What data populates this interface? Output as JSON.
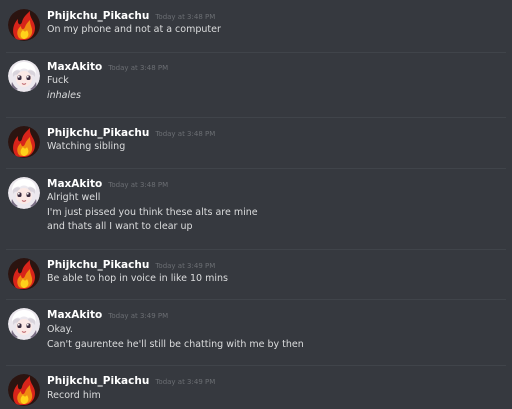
{
  "messages": [
    {
      "author": "Phijkchu_Pikachu",
      "timestamp": "Today at 3:48 PM",
      "lines": [
        "On my phone and not at a computer"
      ]
    },
    {
      "author": "MaxAkito",
      "timestamp": "Today at 3:48 PM",
      "lines": [
        "Fuck",
        "inhales"
      ]
    },
    {
      "author": "Phijkchu_Pikachu",
      "timestamp": "Today at 3:48 PM",
      "lines": [
        "Watching sibling"
      ]
    },
    {
      "author": "MaxAkito",
      "timestamp": "Today at 3:48 PM",
      "lines": [
        "Alright well",
        "I'm just pissed you think these alts are mine",
        "and thats all I want to clear up"
      ]
    },
    {
      "author": "Phijkchu_Pikachu",
      "timestamp": "Today at 3:49 PM",
      "lines": [
        "Be able to hop in voice in like 10 mins"
      ]
    },
    {
      "author": "MaxAkito",
      "timestamp": "Today at 3:49 PM",
      "lines": [
        "Okay.",
        "Can't gaurentee he'll still be chatting with me by then"
      ]
    },
    {
      "author": "Phijkchu_Pikachu",
      "timestamp": "Today at 3:49 PM",
      "lines": [
        "Record him"
      ]
    }
  ],
  "avatars": {
    "phijkchu": "flame-avatar",
    "maxakito": "anime-avatar"
  },
  "colors": {
    "background": "#36393f",
    "username": "#ffffff",
    "text": "#dcddde",
    "timestamp": "#6b6e73",
    "divider": "#40444a"
  }
}
